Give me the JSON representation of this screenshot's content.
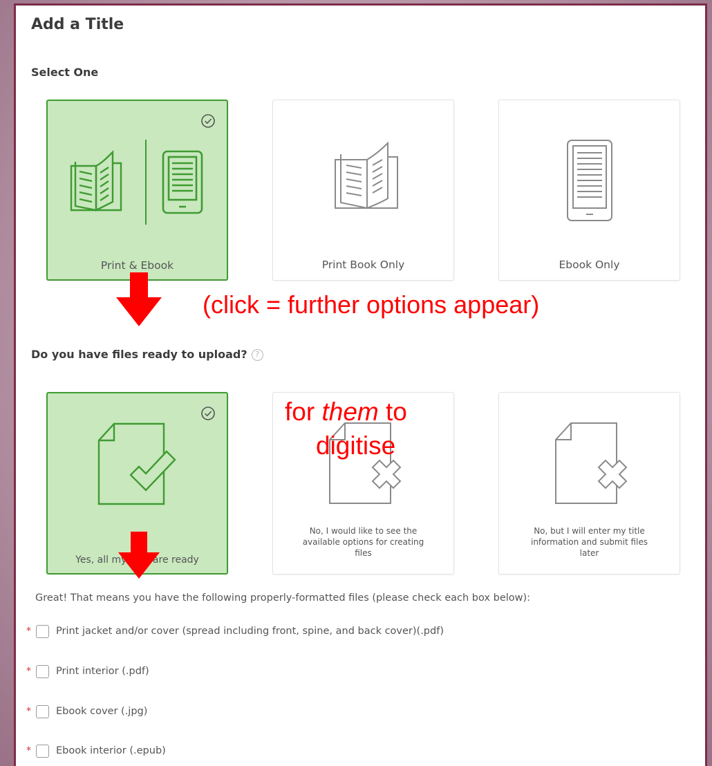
{
  "page": {
    "title": "Add a Title",
    "select_label": "Select One",
    "files_question": "Do you have files ready to upload?",
    "help_glyph": "?"
  },
  "format_options": [
    {
      "label": "Print & Ebook",
      "selected": true
    },
    {
      "label": "Print Book Only",
      "selected": false
    },
    {
      "label": "Ebook Only",
      "selected": false
    }
  ],
  "file_options": [
    {
      "label": "Yes, all my files are ready",
      "selected": true
    },
    {
      "label_lines": [
        "No, I would like to see the",
        "available options for creating",
        "files"
      ],
      "selected": false
    },
    {
      "label_lines": [
        "No, but I will enter my title",
        "information and submit files",
        "later"
      ],
      "selected": false
    }
  ],
  "annotations": {
    "click_note": "(click = further options appear)",
    "them_prefix": "for ",
    "them_word": "them",
    "them_suffix": " to",
    "digitise": "digitise"
  },
  "files": {
    "intro": "Great! That means you have the following properly-formatted files (please check each box below):",
    "required_marker": "*",
    "items": [
      {
        "label": "Print jacket and/or cover (spread including front, spine, and back cover)(.pdf)",
        "checked": false
      },
      {
        "label": "Print interior (.pdf)",
        "checked": false
      },
      {
        "label": "Ebook cover (.jpg)",
        "checked": false
      },
      {
        "label": "Ebook interior (.epub)",
        "checked": false
      }
    ]
  },
  "colors": {
    "selected_bg": "#c9e8be",
    "selected_border": "#3f9b32",
    "annotation": "#ff0000",
    "frame": "#7e2c47"
  }
}
